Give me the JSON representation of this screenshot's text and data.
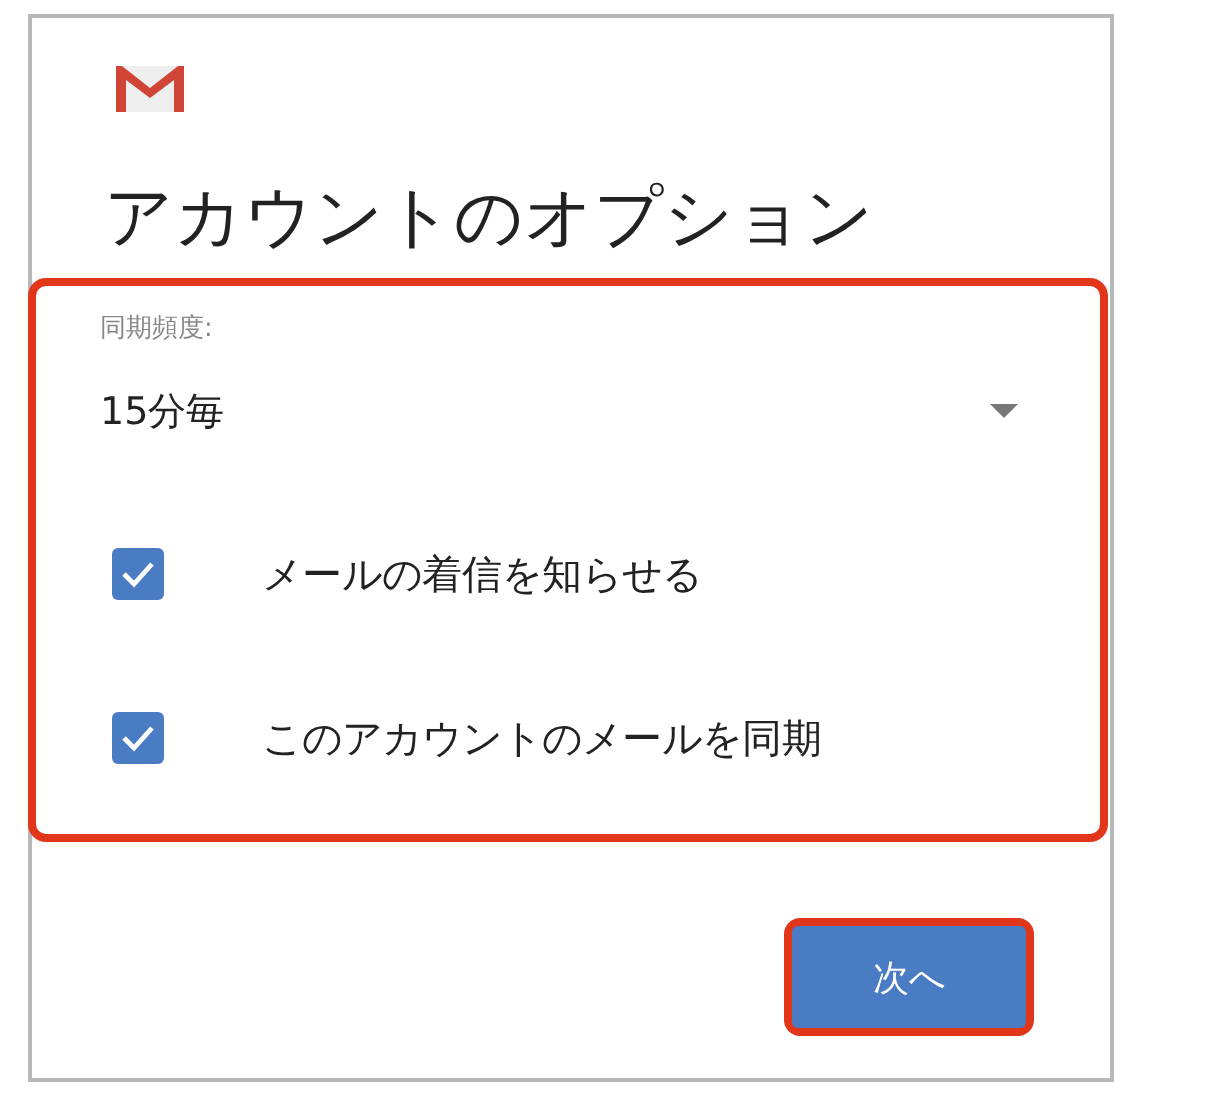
{
  "title": "アカウントのオプション",
  "options": {
    "highlighted": true,
    "sync_frequency": {
      "label": "同期頻度:",
      "value": "15分毎"
    },
    "checkboxes": [
      {
        "label": "メールの着信を知らせる",
        "checked": true
      },
      {
        "label": "このアカウントのメールを同期",
        "checked": true
      }
    ]
  },
  "next_button": {
    "label": "次へ",
    "highlighted": true
  }
}
